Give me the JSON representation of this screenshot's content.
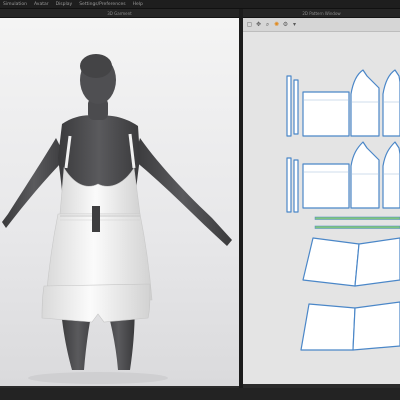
{
  "menubar": {
    "items": [
      "Simulation",
      "Avatar",
      "Display",
      "Settings/Preferences",
      "Help"
    ]
  },
  "windows": {
    "left_title": "3D Garment",
    "right_title": "2D Pattern Window"
  },
  "toolbar2d": {
    "icons": [
      "select-icon",
      "transform-icon",
      "zoom-icon",
      "sun-icon",
      "gear-icon",
      "arrow-icon"
    ]
  },
  "colors": {
    "viewport_bg": "#ebebed",
    "pattern_bg": "#e4e4e4",
    "pattern_outline": "#4b87c8",
    "avatar": "#4a4a4c",
    "garment": "#f3f3f3",
    "accent": "#e08a1e"
  }
}
